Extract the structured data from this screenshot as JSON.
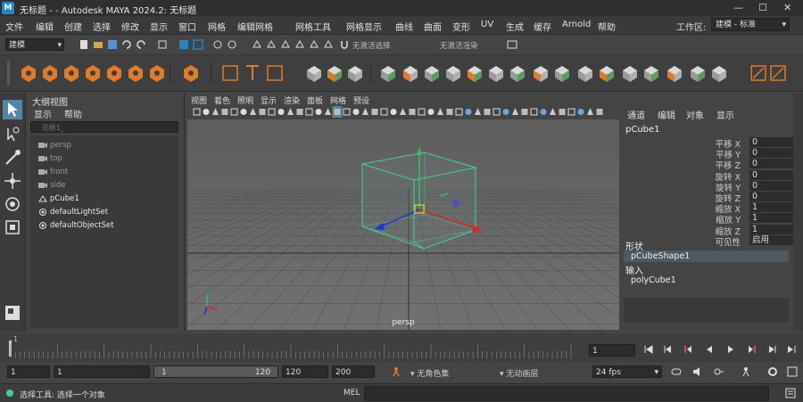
{
  "window": {
    "logo": "M",
    "title": "无标题 - - Autodesk MAYA 2024.2: 无标题",
    "minimize": "—",
    "maximize": "☐",
    "close": "✕"
  },
  "menubar": {
    "items": [
      "文件",
      "编辑",
      "创建",
      "选择",
      "修改",
      "显示",
      "窗口",
      "网格",
      "编辑网格",
      "网格工具",
      "网格显示",
      "曲线",
      "曲面",
      "变形",
      "UV",
      "生成",
      "缓存",
      "Arnold",
      "帮助"
    ],
    "workspace_label": "工作区:",
    "workspace_value": "建模 - 标准"
  },
  "statusline": {
    "mode": "建模",
    "text1": "无激活选择",
    "text2": "无激活渲染"
  },
  "outliner": {
    "title": "大纲视图",
    "menus": [
      "显示",
      "帮助"
    ],
    "search_placeholder": "见框1_",
    "items": [
      "persp",
      "top",
      "front",
      "side",
      "pCube1",
      "defaultLightSet",
      "defaultObjectSet"
    ]
  },
  "viewport": {
    "menus": [
      "视图",
      "着色",
      "照明",
      "显示",
      "渲染",
      "面板",
      "网格",
      "预设"
    ],
    "camera_label": "persp"
  },
  "channelbox": {
    "menus": [
      "通道",
      "编辑",
      "对象",
      "显示"
    ],
    "object_name": "pCube1",
    "attrs": [
      {
        "label": "平移 X",
        "value": "0"
      },
      {
        "label": "平移 Y",
        "value": "0"
      },
      {
        "label": "平移 Z",
        "value": "0"
      },
      {
        "label": "旋转 X",
        "value": "0"
      },
      {
        "label": "旋转 Y",
        "value": "0"
      },
      {
        "label": "旋转 Z",
        "value": "0"
      },
      {
        "label": "缩放 X",
        "value": "1"
      },
      {
        "label": "缩放 Y",
        "value": "1"
      },
      {
        "label": "缩放 Z",
        "value": "1"
      },
      {
        "label": "可见性",
        "value": "启用"
      }
    ],
    "shapes_header": "形状",
    "shape_item": "pCubeShape1",
    "inputs_header": "输入",
    "input_item": "polyCube1"
  },
  "timeslider": {
    "ticks": [
      "1",
      "",
      "",
      "",
      "",
      "",
      "",
      "",
      "",
      "",
      "",
      "",
      "",
      "",
      "",
      "",
      "",
      "",
      ""
    ],
    "current_frame": "1"
  },
  "range": {
    "start": "1",
    "anim_start": "1",
    "slider_start": "1",
    "slider_end": "120",
    "anim_end": "120",
    "end": "200",
    "char_set": "无角色集",
    "anim_layer": "无动画层",
    "fps": "24 fps"
  },
  "cmdline": {
    "help": "选择工具: 选择一个对象",
    "mel_label": "MEL"
  },
  "colors": {
    "accent": "#1f88c9",
    "shelf_orange": "#e07b26",
    "selection_green": "#3ed38a"
  }
}
